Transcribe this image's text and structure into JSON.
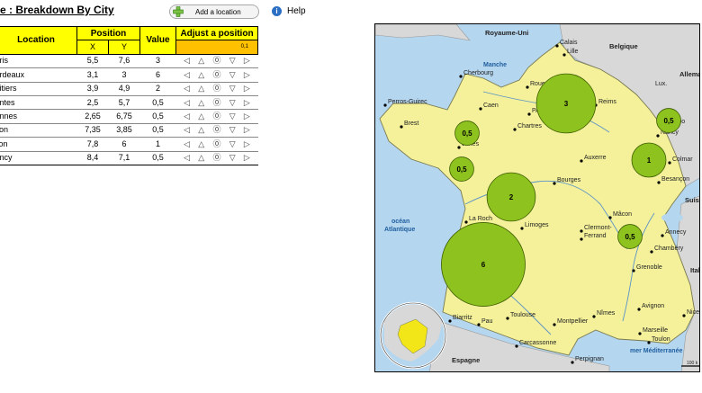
{
  "title": "e : Breakdown By City",
  "add_location_label": "Add a location",
  "help_label": "Help",
  "help_icon": "info-icon",
  "table": {
    "headers": {
      "location": "Location",
      "position": "Position",
      "x": "X",
      "y": "Y",
      "value": "Value",
      "adjust": "Adjust a position",
      "step": "0,1"
    },
    "rows": [
      {
        "location": "aris",
        "x": "5,5",
        "y": "7,6",
        "value": "3"
      },
      {
        "location": "ordeaux",
        "x": "3,1",
        "y": "3",
        "value": "6"
      },
      {
        "location": "oitiers",
        "x": "3,9",
        "y": "4,9",
        "value": "2"
      },
      {
        "location": "antes",
        "x": "2,5",
        "y": "5,7",
        "value": "0,5"
      },
      {
        "location": "ennes",
        "x": "2,65",
        "y": "6,75",
        "value": "0,5"
      },
      {
        "location": "yon",
        "x": "7,35",
        "y": "3,85",
        "value": "0,5"
      },
      {
        "location": "ijon",
        "x": "7,8",
        "y": "6",
        "value": "1"
      },
      {
        "location": "ancy",
        "x": "8,4",
        "y": "7,1",
        "value": "0,5"
      }
    ],
    "adjust_icons": [
      "arrow-left-icon",
      "arrow-up-icon",
      "target-icon",
      "arrow-down-icon",
      "arrow-right-icon"
    ],
    "adjust_glyphs": [
      "◁",
      "△",
      "⓪",
      "▽",
      "▷"
    ]
  },
  "map": {
    "sea_labels": [
      "Manche",
      "océan",
      "Atlantique",
      "mer Méditerranée"
    ],
    "country_labels": [
      "Royaume-Uni",
      "Belgique",
      "Allema",
      "Lux.",
      "Suiss",
      "Ital",
      "Espagne"
    ],
    "city_labels": [
      "Calais",
      "Lille",
      "Cherbourg",
      "Caen",
      "Perros-Guirec",
      "Brest",
      "Rouen",
      "PA",
      "Reims",
      "Chartres",
      "ennes",
      "Strasbo",
      "Nancy",
      "Colmar",
      "Besançon",
      "Auxerre",
      "Bourges",
      "rs",
      "La Roch",
      "Limoges",
      "Clermont-",
      "Ferrand",
      "Mâcon",
      "Annecy",
      "Chambéry",
      "Grenoble",
      "Avignon",
      "Nîmes",
      "Montpellier",
      "Marseille",
      "Toulon",
      "Nice",
      "Biarritz",
      "Pau",
      "Toulouse",
      "Carcassonne",
      "Perpignan"
    ],
    "scale_label": "100 k",
    "bubbles": [
      {
        "label": "3",
        "value": 3
      },
      {
        "label": "0,5",
        "value": 0.5
      },
      {
        "label": "1",
        "value": 1
      },
      {
        "label": "0,5",
        "value": 0.5
      },
      {
        "label": "0,5",
        "value": 0.5
      },
      {
        "label": "2",
        "value": 2
      },
      {
        "label": "6",
        "value": 6
      },
      {
        "label": "0,5",
        "value": 0.5
      }
    ]
  },
  "colors": {
    "header_yellow": "#ffff00",
    "step_orange": "#ffc000",
    "bubble_green": "#8dc21f",
    "land_france": "#f4f19a",
    "land_other": "#d8d8d8",
    "sea": "#b5d6ef"
  }
}
